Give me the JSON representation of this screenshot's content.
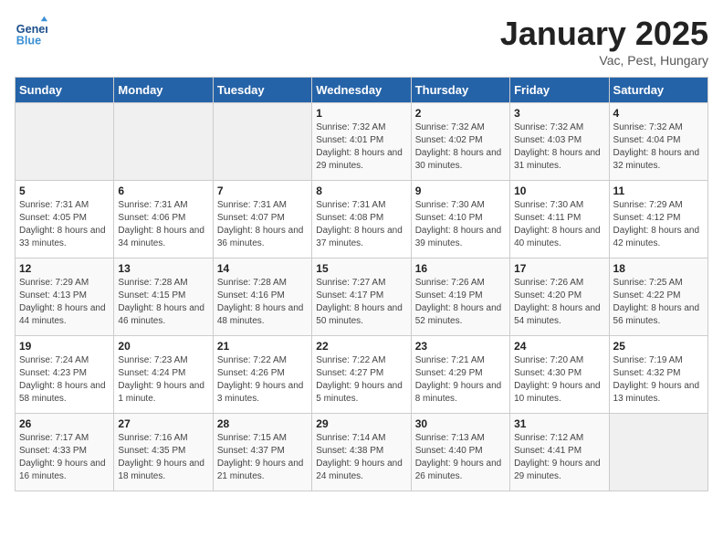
{
  "logo": {
    "line1": "General",
    "line2": "Blue"
  },
  "title": "January 2025",
  "subtitle": "Vac, Pest, Hungary",
  "days_of_week": [
    "Sunday",
    "Monday",
    "Tuesday",
    "Wednesday",
    "Thursday",
    "Friday",
    "Saturday"
  ],
  "weeks": [
    [
      {
        "day": "",
        "empty": true
      },
      {
        "day": "",
        "empty": true
      },
      {
        "day": "",
        "empty": true
      },
      {
        "day": "1",
        "sunrise": "7:32 AM",
        "sunset": "4:01 PM",
        "daylight": "8 hours and 29 minutes."
      },
      {
        "day": "2",
        "sunrise": "7:32 AM",
        "sunset": "4:02 PM",
        "daylight": "8 hours and 30 minutes."
      },
      {
        "day": "3",
        "sunrise": "7:32 AM",
        "sunset": "4:03 PM",
        "daylight": "8 hours and 31 minutes."
      },
      {
        "day": "4",
        "sunrise": "7:32 AM",
        "sunset": "4:04 PM",
        "daylight": "8 hours and 32 minutes."
      }
    ],
    [
      {
        "day": "5",
        "sunrise": "7:31 AM",
        "sunset": "4:05 PM",
        "daylight": "8 hours and 33 minutes."
      },
      {
        "day": "6",
        "sunrise": "7:31 AM",
        "sunset": "4:06 PM",
        "daylight": "8 hours and 34 minutes."
      },
      {
        "day": "7",
        "sunrise": "7:31 AM",
        "sunset": "4:07 PM",
        "daylight": "8 hours and 36 minutes."
      },
      {
        "day": "8",
        "sunrise": "7:31 AM",
        "sunset": "4:08 PM",
        "daylight": "8 hours and 37 minutes."
      },
      {
        "day": "9",
        "sunrise": "7:30 AM",
        "sunset": "4:10 PM",
        "daylight": "8 hours and 39 minutes."
      },
      {
        "day": "10",
        "sunrise": "7:30 AM",
        "sunset": "4:11 PM",
        "daylight": "8 hours and 40 minutes."
      },
      {
        "day": "11",
        "sunrise": "7:29 AM",
        "sunset": "4:12 PM",
        "daylight": "8 hours and 42 minutes."
      }
    ],
    [
      {
        "day": "12",
        "sunrise": "7:29 AM",
        "sunset": "4:13 PM",
        "daylight": "8 hours and 44 minutes."
      },
      {
        "day": "13",
        "sunrise": "7:28 AM",
        "sunset": "4:15 PM",
        "daylight": "8 hours and 46 minutes."
      },
      {
        "day": "14",
        "sunrise": "7:28 AM",
        "sunset": "4:16 PM",
        "daylight": "8 hours and 48 minutes."
      },
      {
        "day": "15",
        "sunrise": "7:27 AM",
        "sunset": "4:17 PM",
        "daylight": "8 hours and 50 minutes."
      },
      {
        "day": "16",
        "sunrise": "7:26 AM",
        "sunset": "4:19 PM",
        "daylight": "8 hours and 52 minutes."
      },
      {
        "day": "17",
        "sunrise": "7:26 AM",
        "sunset": "4:20 PM",
        "daylight": "8 hours and 54 minutes."
      },
      {
        "day": "18",
        "sunrise": "7:25 AM",
        "sunset": "4:22 PM",
        "daylight": "8 hours and 56 minutes."
      }
    ],
    [
      {
        "day": "19",
        "sunrise": "7:24 AM",
        "sunset": "4:23 PM",
        "daylight": "8 hours and 58 minutes."
      },
      {
        "day": "20",
        "sunrise": "7:23 AM",
        "sunset": "4:24 PM",
        "daylight": "9 hours and 1 minute."
      },
      {
        "day": "21",
        "sunrise": "7:22 AM",
        "sunset": "4:26 PM",
        "daylight": "9 hours and 3 minutes."
      },
      {
        "day": "22",
        "sunrise": "7:22 AM",
        "sunset": "4:27 PM",
        "daylight": "9 hours and 5 minutes."
      },
      {
        "day": "23",
        "sunrise": "7:21 AM",
        "sunset": "4:29 PM",
        "daylight": "9 hours and 8 minutes."
      },
      {
        "day": "24",
        "sunrise": "7:20 AM",
        "sunset": "4:30 PM",
        "daylight": "9 hours and 10 minutes."
      },
      {
        "day": "25",
        "sunrise": "7:19 AM",
        "sunset": "4:32 PM",
        "daylight": "9 hours and 13 minutes."
      }
    ],
    [
      {
        "day": "26",
        "sunrise": "7:17 AM",
        "sunset": "4:33 PM",
        "daylight": "9 hours and 16 minutes."
      },
      {
        "day": "27",
        "sunrise": "7:16 AM",
        "sunset": "4:35 PM",
        "daylight": "9 hours and 18 minutes."
      },
      {
        "day": "28",
        "sunrise": "7:15 AM",
        "sunset": "4:37 PM",
        "daylight": "9 hours and 21 minutes."
      },
      {
        "day": "29",
        "sunrise": "7:14 AM",
        "sunset": "4:38 PM",
        "daylight": "9 hours and 24 minutes."
      },
      {
        "day": "30",
        "sunrise": "7:13 AM",
        "sunset": "4:40 PM",
        "daylight": "9 hours and 26 minutes."
      },
      {
        "day": "31",
        "sunrise": "7:12 AM",
        "sunset": "4:41 PM",
        "daylight": "9 hours and 29 minutes."
      },
      {
        "day": "",
        "empty": true
      }
    ]
  ],
  "labels": {
    "sunrise": "Sunrise:",
    "sunset": "Sunset:",
    "daylight": "Daylight:"
  }
}
